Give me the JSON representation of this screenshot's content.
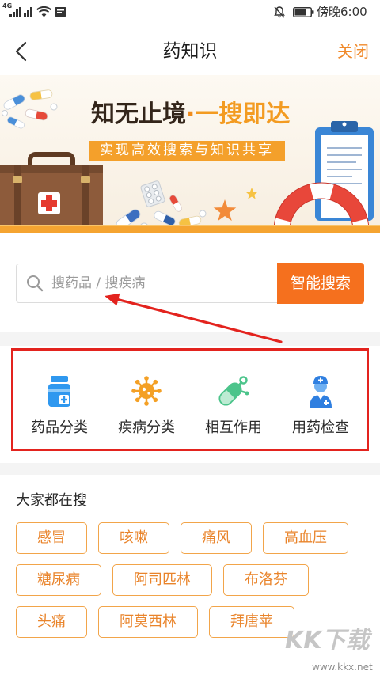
{
  "status_bar": {
    "network_label": "4G",
    "time": "傍晚6:00",
    "battery_level": 0.75,
    "icons": [
      "signal-icon",
      "signal-icon",
      "wifi-icon",
      "notification-app-icon",
      "bell-off-icon",
      "battery-icon"
    ]
  },
  "nav": {
    "back_icon": "chevron-left-icon",
    "title": "药知识",
    "close_label": "关闭"
  },
  "banner": {
    "title_main": "知无止境",
    "title_dot": "·",
    "title_accent": "一搜即达",
    "subtitle": "实现高效搜索与知识共享"
  },
  "search": {
    "icon": "search-icon",
    "placeholder": "搜药品 / 搜疾病",
    "button_label": "智能搜索"
  },
  "categories": [
    {
      "label": "药品分类",
      "icon": "medicine-bottle-icon"
    },
    {
      "label": "疾病分类",
      "icon": "virus-icon"
    },
    {
      "label": "相互作用",
      "icon": "capsule-interaction-icon"
    },
    {
      "label": "用药检查",
      "icon": "doctor-icon"
    }
  ],
  "popular": {
    "heading": "大家都在搜",
    "tags": [
      "感冒",
      "咳嗽",
      "痛风",
      "高血压",
      "糖尿病",
      "阿司匹林",
      "布洛芬",
      "头痛",
      "阿莫西林",
      "拜唐苹"
    ]
  },
  "watermark": {
    "brand": "KK下载",
    "url": "www.kkx.net"
  },
  "colors": {
    "accent": "#f5701e",
    "close_text": "#f08a2b",
    "tag_border": "#f2a54a",
    "tag_text": "#e9842b",
    "banner_strip": "#f5a431",
    "annotation": "#e3231e"
  }
}
